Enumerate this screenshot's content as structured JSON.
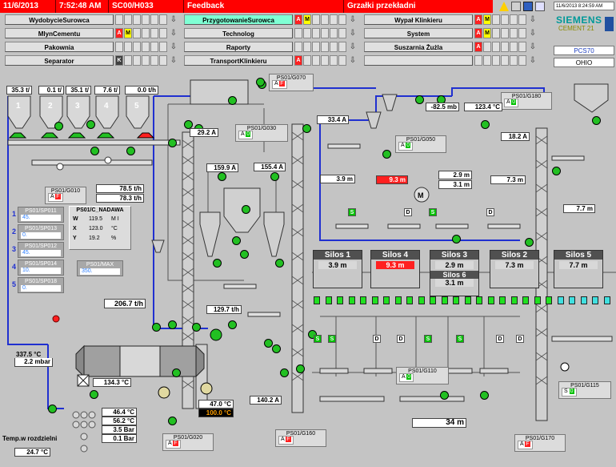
{
  "header": {
    "date": "11/6/2013",
    "time": "7:52:48 AM",
    "screen_id": "SC00/H033",
    "feedback": "Feedback",
    "alarm": "Grzałki przekładni",
    "clock": "11/6/2013 8:24:59 AM"
  },
  "brand": {
    "name": "SIEMENS",
    "sub": "CEMENT 21"
  },
  "nav": {
    "col1": [
      "WydobycieSurowca",
      "MlynCementu",
      "Pakownia",
      "Separator"
    ],
    "col2": [
      "PrzygotowanieSurowca",
      "Technolog",
      "Raporty",
      "TransportKlinkieru"
    ],
    "col3": [
      "Wypał Klinkieru",
      "System",
      "Suszarnia Żużla",
      ""
    ]
  },
  "system": {
    "pcs": "PCS70",
    "station": "OHIO"
  },
  "feeders": {
    "values": [
      "35.3 t/",
      "0.1 t/",
      "35.1 t/",
      "7.6 t/",
      "0.0 t/h"
    ],
    "numbers": [
      "1",
      "2",
      "3",
      "4",
      "5"
    ]
  },
  "g010": {
    "name": "PS01/G010",
    "mode": "A",
    "status": "F"
  },
  "feed_rates": [
    "78.5 t/h",
    "78.3 t/h"
  ],
  "setpoints": {
    "items": [
      {
        "n": "1",
        "name": "PS01/SP011",
        "value": "45."
      },
      {
        "n": "2",
        "name": "PS01/SP013",
        "value": "0."
      },
      {
        "n": "3",
        "name": "PS01/SP012",
        "value": "45."
      },
      {
        "n": "4",
        "name": "PS01/SP014",
        "value": "10."
      },
      {
        "n": "5",
        "name": "PS01/SP018",
        "value": "0."
      }
    ]
  },
  "nadawa": {
    "title": "PS01/C_NADAWA",
    "rows": [
      {
        "k": "W",
        "v": "119.5",
        "u": "M I"
      },
      {
        "k": "X",
        "v": "123.0",
        "u": "°C"
      },
      {
        "k": "Y",
        "v": "19.2",
        "u": "%"
      }
    ]
  },
  "max": {
    "name": "PS01/MAX",
    "value": "350."
  },
  "total_feed": "206.7 t/h",
  "mill": {
    "temp_in": "337.5 °C",
    "pressure": "2.2 mbar",
    "temp_label": "Temp.w rozdzielni",
    "temp_value": "24.7 °C",
    "outlet_temp": "134.3 °C",
    "readings": [
      "46.4 °C",
      "56.2 °C",
      "3.5 Bar",
      "0.1 Bar"
    ],
    "motor_temp": "47.0 °C",
    "motor_temp2": "100.0 °C"
  },
  "g020": {
    "name": "PS01/G020",
    "mode": "A",
    "status": "F"
  },
  "g070": {
    "name": "PS01/G070",
    "mode": "A",
    "status": "F"
  },
  "g030": {
    "name": "PS01/G030",
    "mode": "A",
    "status": "0"
  },
  "g050": {
    "name": "PS01/G050",
    "mode": "A",
    "status": "0"
  },
  "g180": {
    "name": "PS01/G180",
    "mode": "A",
    "status": "0"
  },
  "g110": {
    "name": "PS01/G110",
    "mode": "A",
    "status": "0"
  },
  "g115": {
    "name": "PS01/G115",
    "mode": "S",
    "status": "0"
  },
  "g160": {
    "name": "PS01/G160",
    "mode": "A",
    "status": "F"
  },
  "g170": {
    "name": "PS01/G170",
    "mode": "A",
    "status": "F"
  },
  "currents": {
    "a1": "29.2 A",
    "a2": "159.9 A",
    "a3": "155.4 A",
    "a4": "33.4 A",
    "a5": "129.7 t/h",
    "a6": "140.2 A"
  },
  "process": {
    "pressure_mb": "-82.5 mb",
    "temp_top": "123.4 °C",
    "level_18": "18.2 A",
    "lev_39": "3.9 m",
    "lev_93": "9.3 m",
    "lev_29": "2.9 m",
    "lev_31": "3.1 m",
    "lev_73": "7.3 m",
    "lev_77": "7.7 m",
    "height": "34 m"
  },
  "silos": [
    {
      "name": "Silos 1",
      "value": "3.9 m",
      "red": false
    },
    {
      "name": "Silos 4",
      "value": "9.3 m",
      "red": true
    },
    {
      "name": "Silos 3",
      "value": "2.9 m",
      "name2": "Silos 6",
      "value2": "3.1 m",
      "red": false
    },
    {
      "name": "Silos 2",
      "value": "7.3 m",
      "red": false
    },
    {
      "name": "Silos 5",
      "value": "7.7 m",
      "red": false
    }
  ],
  "selectors": {
    "row1": [
      "S",
      "D",
      "S",
      "D"
    ],
    "row2": [
      "S",
      "S",
      "D",
      "D",
      "S",
      "S",
      "D",
      "D"
    ]
  }
}
